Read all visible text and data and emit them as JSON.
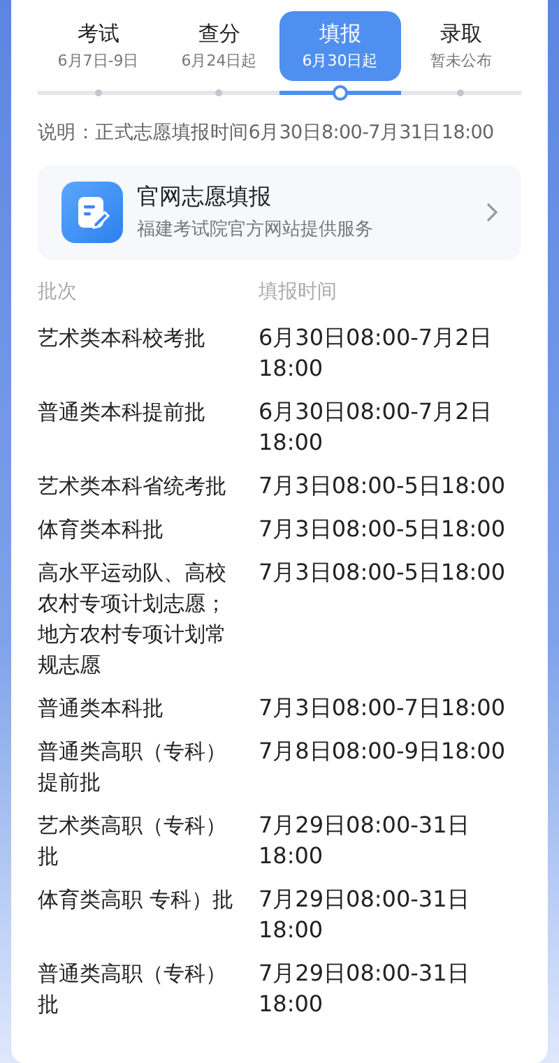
{
  "tabs": [
    {
      "title": "考试",
      "date": "6月7日-9日",
      "selected": false
    },
    {
      "title": "查分",
      "date": "6月24日起",
      "selected": false
    },
    {
      "title": "填报",
      "date": "6月30日起",
      "selected": true
    },
    {
      "title": "录取",
      "date": "暂未公布",
      "selected": false
    }
  ],
  "note": "说明：正式志愿填报时间6月30日8:00-7月31日18:00",
  "service": {
    "title": "官网志愿填报",
    "subtitle": "福建考试院官方网站提供服务"
  },
  "table": {
    "columns": [
      "批次",
      "填报时间"
    ],
    "rows": [
      [
        "艺术类本科校考批",
        "6月30日08:00-7月2日18:00"
      ],
      [
        "普通类本科提前批",
        "6月30日08:00-7月2日18:00"
      ],
      [
        "艺术类本科省统考批",
        "7月3日08:00-5日18:00"
      ],
      [
        "体育类本科批",
        "7月3日08:00-5日18:00"
      ],
      [
        "高水平运动队、高校农村专项计划志愿；地方农村专项计划常规志愿",
        "7月3日08:00-5日18:00"
      ],
      [
        "普通类本科批",
        "7月3日08:00-7日18:00"
      ],
      [
        "普通类高职（专科）提前批",
        "7月8日08:00-9日18:00"
      ],
      [
        "艺术类高职（专科）批",
        "7月29日08:00-31日18:00"
      ],
      [
        "体育类高职 专科）批",
        "7月29日08:00-31日18:00"
      ],
      [
        "普通类高职（专科）批",
        "7月29日08:00-31日18:00"
      ]
    ]
  }
}
